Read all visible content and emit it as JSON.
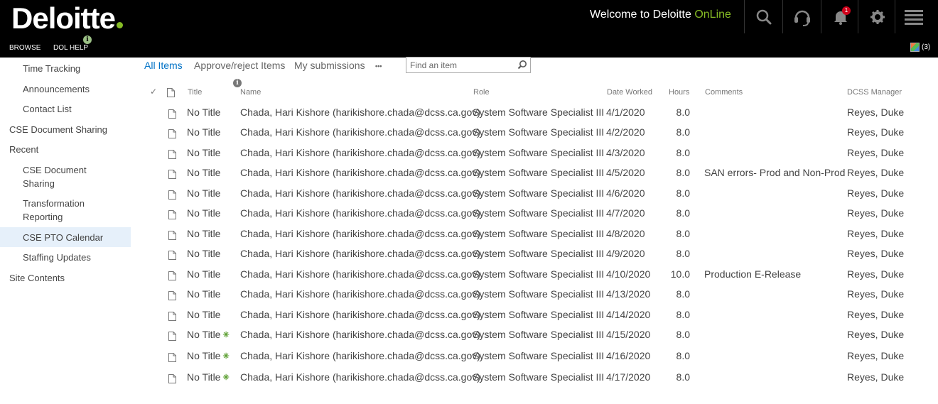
{
  "header": {
    "logo": "Deloitte",
    "welcome_prefix": "Welcome to Deloitte ",
    "welcome_accent": "OnLine",
    "nav": {
      "browse": "BROWSE",
      "help": "DOL HELP"
    },
    "notification_count": "1",
    "user_count": "(3)"
  },
  "sidebar": {
    "items": [
      {
        "label": "Time Tracking"
      },
      {
        "label": "Announcements"
      },
      {
        "label": "Contact List"
      },
      {
        "label": "CSE Document Sharing"
      },
      {
        "label": "Recent"
      },
      {
        "label": "CSE Document Sharing"
      },
      {
        "label": "Transformation Reporting"
      },
      {
        "label": "CSE PTO Calendar"
      },
      {
        "label": "Staffing Updates"
      },
      {
        "label": "Site Contents"
      }
    ]
  },
  "views": {
    "all_items": "All Items",
    "approve": "Approve/reject Items",
    "my_submissions": "My submissions",
    "more": "•••"
  },
  "search": {
    "placeholder": "Find an item"
  },
  "columns": {
    "check": "✓",
    "title": "Title",
    "name": "Name",
    "role": "Role",
    "date": "Date Worked",
    "hours": "Hours",
    "comments": "Comments",
    "manager": "DCSS Manager"
  },
  "rows": [
    {
      "title": "No Title",
      "name": "Chada, Hari Kishore (harikishore.chada@dcss.ca.gov)",
      "role": "System Software Specialist III",
      "date": "4/1/2020",
      "hours": "8.0",
      "comments": "",
      "manager": "Reyes, Duke",
      "new": false
    },
    {
      "title": "No Title",
      "name": "Chada, Hari Kishore (harikishore.chada@dcss.ca.gov)",
      "role": "System Software Specialist III",
      "date": "4/2/2020",
      "hours": "8.0",
      "comments": "",
      "manager": "Reyes, Duke",
      "new": false
    },
    {
      "title": "No Title",
      "name": "Chada, Hari Kishore (harikishore.chada@dcss.ca.gov)",
      "role": "System Software Specialist III",
      "date": "4/3/2020",
      "hours": "8.0",
      "comments": "",
      "manager": "Reyes, Duke",
      "new": false
    },
    {
      "title": "No Title",
      "name": "Chada, Hari Kishore (harikishore.chada@dcss.ca.gov)",
      "role": "System Software Specialist III",
      "date": "4/5/2020",
      "hours": "8.0",
      "comments": "SAN errors- Prod and Non-Prod",
      "manager": "Reyes, Duke",
      "new": false
    },
    {
      "title": "No Title",
      "name": "Chada, Hari Kishore (harikishore.chada@dcss.ca.gov)",
      "role": "System Software Specialist III",
      "date": "4/6/2020",
      "hours": "8.0",
      "comments": "",
      "manager": "Reyes, Duke",
      "new": false
    },
    {
      "title": "No Title",
      "name": "Chada, Hari Kishore (harikishore.chada@dcss.ca.gov)",
      "role": "System Software Specialist III",
      "date": "4/7/2020",
      "hours": "8.0",
      "comments": "",
      "manager": "Reyes, Duke",
      "new": false
    },
    {
      "title": "No Title",
      "name": "Chada, Hari Kishore (harikishore.chada@dcss.ca.gov)",
      "role": "System Software Specialist III",
      "date": "4/8/2020",
      "hours": "8.0",
      "comments": "",
      "manager": "Reyes, Duke",
      "new": false
    },
    {
      "title": "No Title",
      "name": "Chada, Hari Kishore (harikishore.chada@dcss.ca.gov)",
      "role": "System Software Specialist III",
      "date": "4/9/2020",
      "hours": "8.0",
      "comments": "",
      "manager": "Reyes, Duke",
      "new": false
    },
    {
      "title": "No Title",
      "name": "Chada, Hari Kishore (harikishore.chada@dcss.ca.gov)",
      "role": "System Software Specialist III",
      "date": "4/10/2020",
      "hours": "10.0",
      "comments": "Production E-Release",
      "manager": "Reyes, Duke",
      "new": false
    },
    {
      "title": "No Title",
      "name": "Chada, Hari Kishore (harikishore.chada@dcss.ca.gov)",
      "role": "System Software Specialist III",
      "date": "4/13/2020",
      "hours": "8.0",
      "comments": "",
      "manager": "Reyes, Duke",
      "new": false
    },
    {
      "title": "No Title",
      "name": "Chada, Hari Kishore (harikishore.chada@dcss.ca.gov)",
      "role": "System Software Specialist III",
      "date": "4/14/2020",
      "hours": "8.0",
      "comments": "",
      "manager": "Reyes, Duke",
      "new": false
    },
    {
      "title": "No Title",
      "name": "Chada, Hari Kishore (harikishore.chada@dcss.ca.gov)",
      "role": "System Software Specialist III",
      "date": "4/15/2020",
      "hours": "8.0",
      "comments": "",
      "manager": "Reyes, Duke",
      "new": true
    },
    {
      "title": "No Title",
      "name": "Chada, Hari Kishore (harikishore.chada@dcss.ca.gov)",
      "role": "System Software Specialist III",
      "date": "4/16/2020",
      "hours": "8.0",
      "comments": "",
      "manager": "Reyes, Duke",
      "new": true
    },
    {
      "title": "No Title",
      "name": "Chada, Hari Kishore (harikishore.chada@dcss.ca.gov)",
      "role": "System Software Specialist III",
      "date": "4/17/2020",
      "hours": "8.0",
      "comments": "",
      "manager": "Reyes, Duke",
      "new": true
    }
  ]
}
